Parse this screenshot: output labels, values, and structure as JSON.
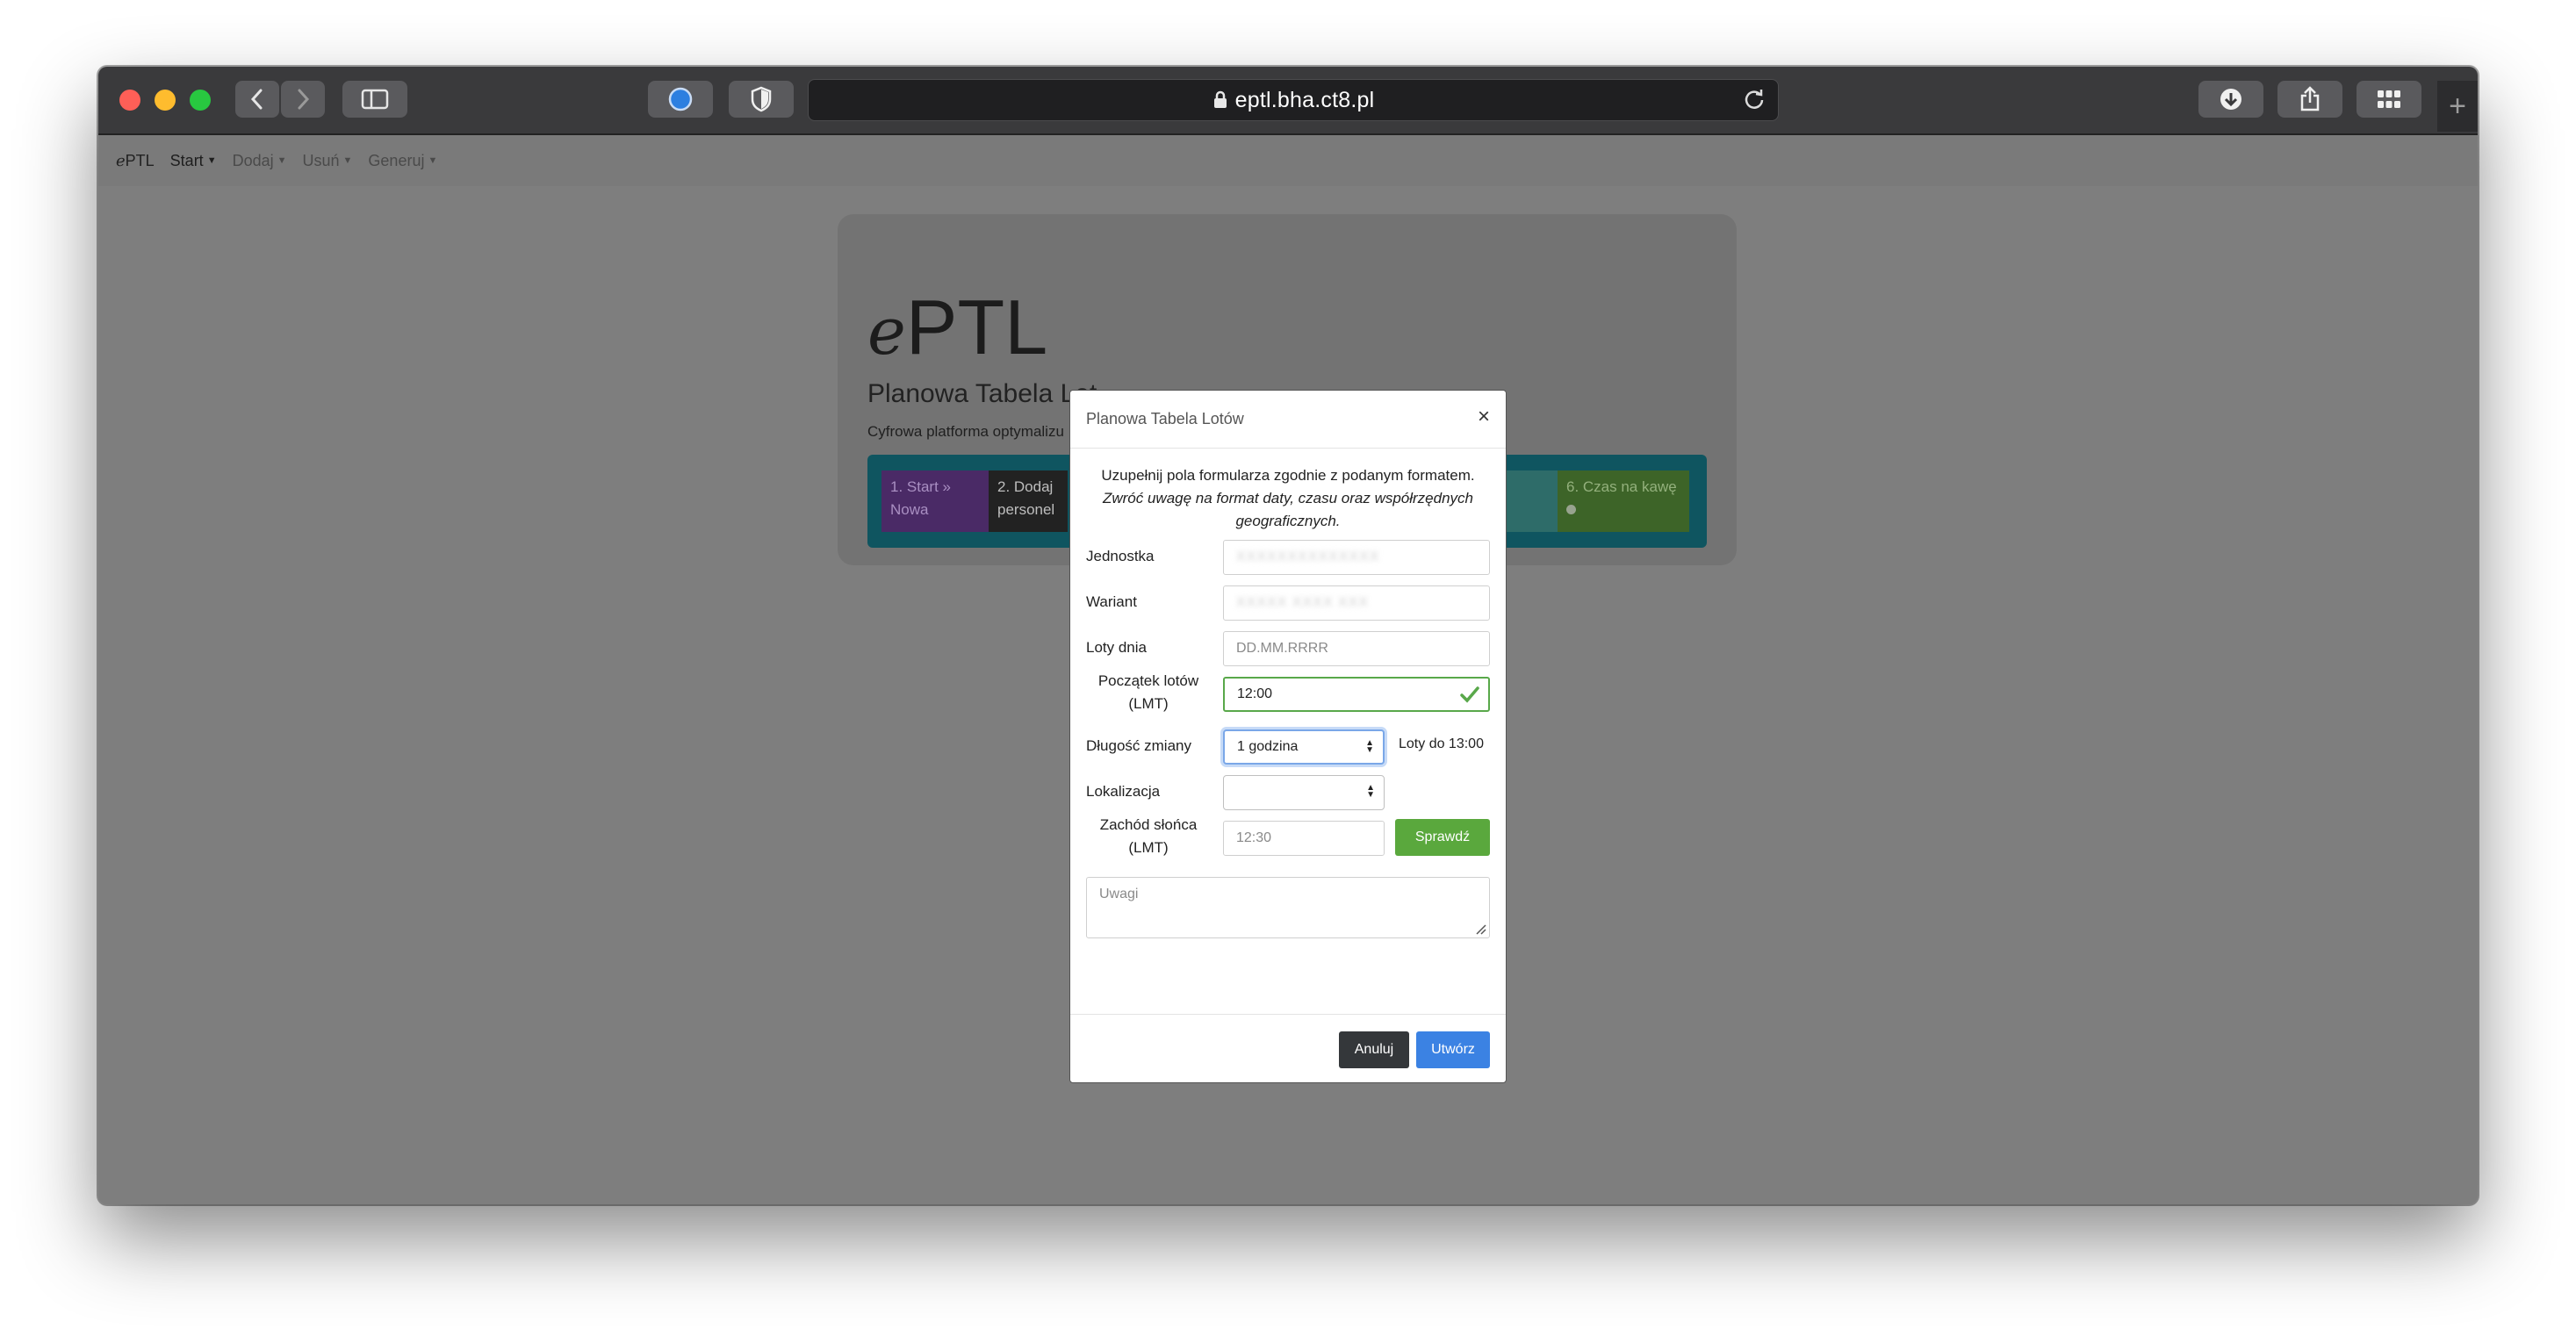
{
  "browser": {
    "url": "eptl.bha.ct8.pl",
    "new_tab_symbol": "+"
  },
  "navbar": {
    "brand_e": "e",
    "brand_rest": "PTL",
    "items": [
      {
        "label": "Start"
      },
      {
        "label": "Dodaj"
      },
      {
        "label": "Usuń"
      },
      {
        "label": "Generuj"
      }
    ]
  },
  "jumbotron": {
    "logo_e": "e",
    "logo_rest": "PTL",
    "title": "Planowa Tabela Lot",
    "description": "Cyfrowa platforma optymalizu",
    "steps": [
      {
        "line1": "1. Start »",
        "line2": "Nowa"
      },
      {
        "line1": "2. Dodaj",
        "line2": "personel"
      },
      {
        "line1": "6. Czas na kawę",
        "line2": ""
      }
    ]
  },
  "modal": {
    "title": "Planowa Tabela Lotów",
    "close": "×",
    "info_line1": "Uzupełnij pola formularza zgodnie z podanym formatem.",
    "info_line2": "Zwróć uwagę na format daty, czasu oraz współrzędnych geograficznych.",
    "fields": {
      "unit_label": "Jednostka",
      "unit_value": "XXXXXXXXXXXXXX",
      "variant_label": "Wariant",
      "variant_value": "XXXXX XXXX XXX",
      "day_label": "Loty dnia",
      "day_placeholder": "DD.MM.RRRR",
      "start_label_1": "Początek lotów",
      "start_label_2": "(LMT)",
      "start_value": "12:00",
      "shift_label": "Długość zmiany",
      "shift_value": "1 godzina",
      "flights_until": "Loty do 13:00",
      "location_label": "Lokalizacja",
      "location_value": "",
      "sunset_label_1": "Zachód słońca",
      "sunset_label_2": "(LMT)",
      "sunset_placeholder": "12:30",
      "check_button": "Sprawdź",
      "notes_placeholder": "Uwagi"
    },
    "cancel_button": "Anuluj",
    "create_button": "Utwórz"
  },
  "colors": {
    "accent_blue": "#3b82e3",
    "success_green": "#5aa83d",
    "dark_button": "#34373a"
  }
}
